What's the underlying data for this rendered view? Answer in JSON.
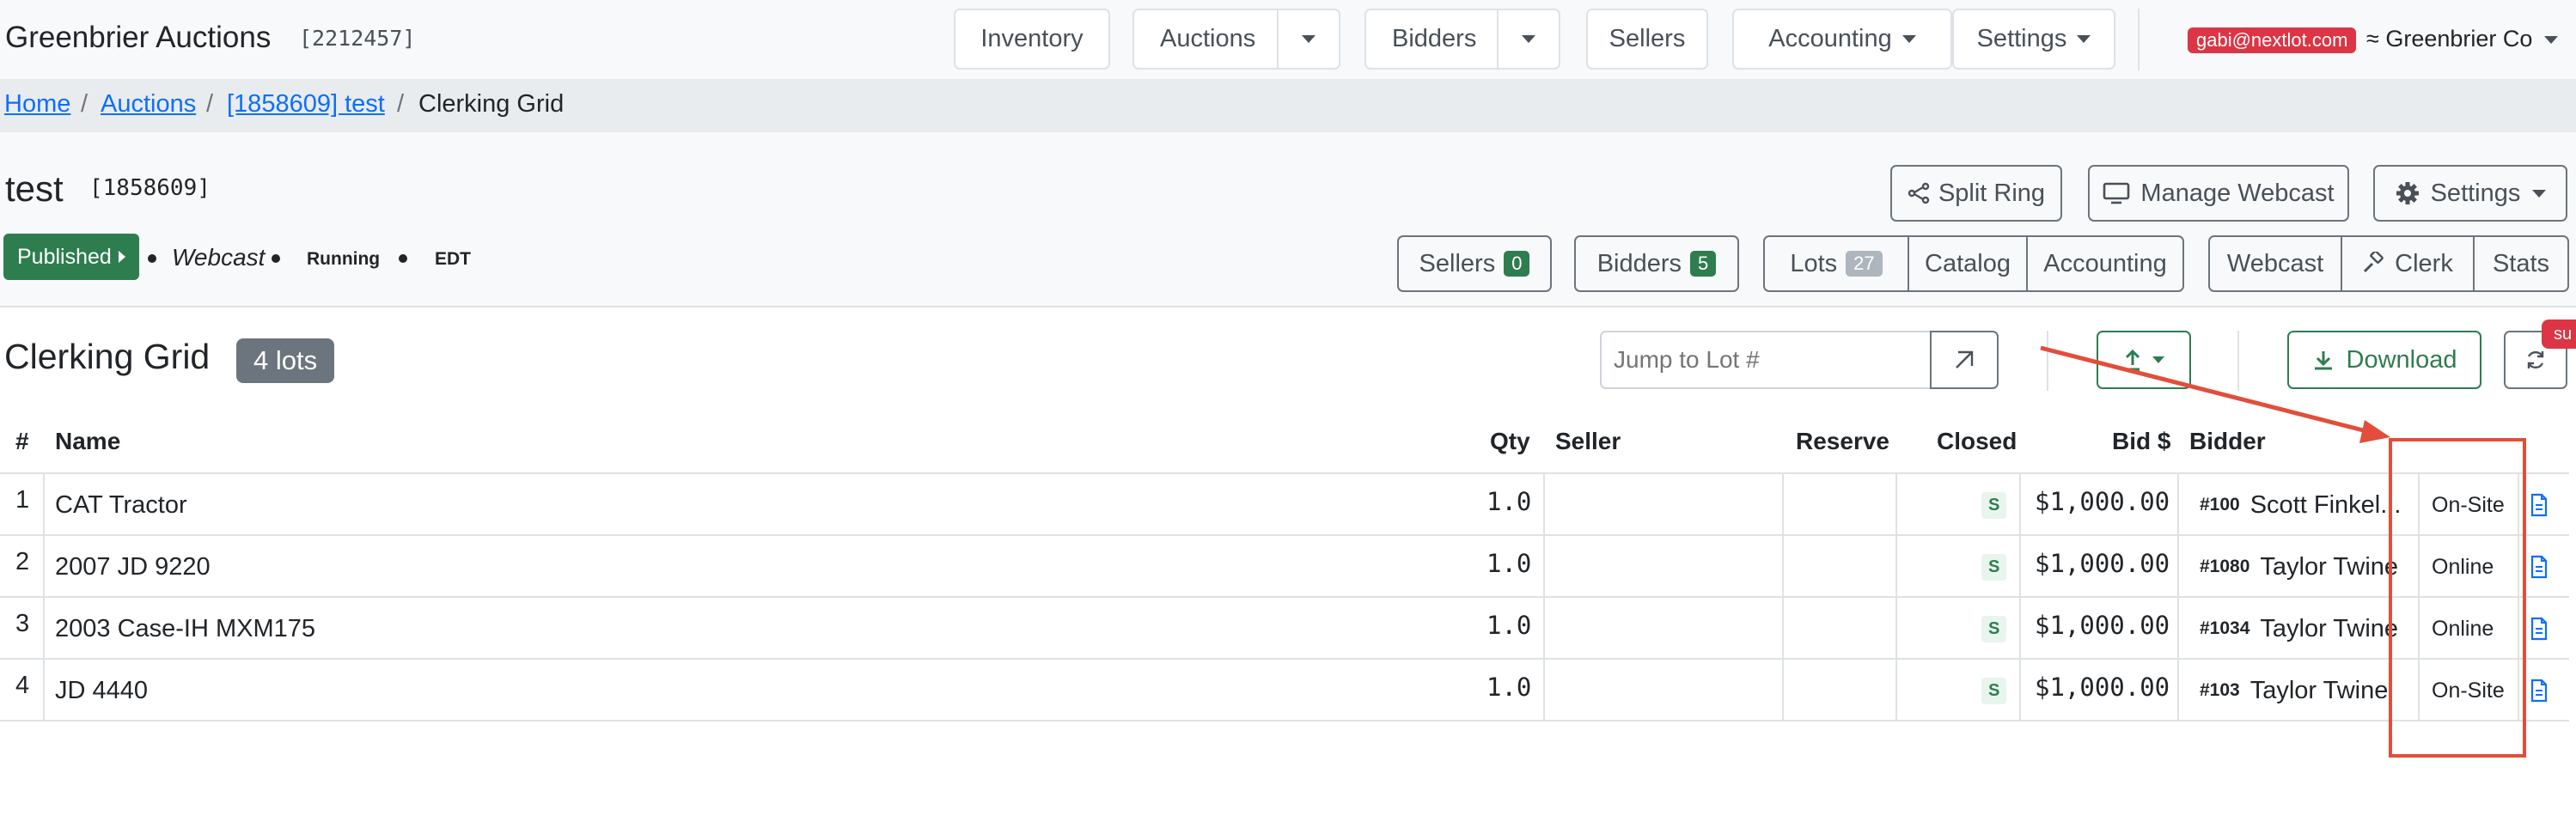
{
  "navbar": {
    "brand": "Greenbrier Auctions",
    "account_id": "[2212457]",
    "inventory": "Inventory",
    "auctions": "Auctions",
    "bidders": "Bidders",
    "sellers": "Sellers",
    "accounting": "Accounting",
    "settings": "Settings",
    "user_email": "gabi@nextlot.com",
    "org": "≈ Greenbrier Co"
  },
  "breadcrumb": {
    "home": "Home",
    "auctions": "Auctions",
    "auction": "[1858609] test",
    "current": "Clerking Grid",
    "sep": "/"
  },
  "auction": {
    "title": "test",
    "id": "[1858609]",
    "status_button": "Published",
    "type": "Webcast",
    "state": "Running",
    "timezone": "EDT",
    "split_ring": "Split Ring",
    "manage_webcast": "Manage Webcast",
    "settings": "Settings",
    "tabs": {
      "sellers": "Sellers",
      "sellers_count": "0",
      "bidders": "Bidders",
      "bidders_count": "5",
      "lots": "Lots",
      "lots_count": "27",
      "catalog": "Catalog",
      "accounting": "Accounting",
      "webcast": "Webcast",
      "clerk": "Clerk",
      "stats": "Stats"
    }
  },
  "grid": {
    "title": "Clerking Grid",
    "lots_badge": "4 lots",
    "jump_placeholder": "Jump to Lot #",
    "download": "Download",
    "corner_badge": "su",
    "columns": {
      "num": "#",
      "name": "Name",
      "qty": "Qty",
      "seller": "Seller",
      "reserve": "Reserve",
      "closed": "Closed",
      "bid": "Bid $",
      "bidder": "Bidder"
    },
    "rows": [
      {
        "num": "1",
        "name": "CAT Tractor",
        "qty": "1.0",
        "closed": "S",
        "bid": "$1,000.00",
        "bidder_num": "#100",
        "bidder_name": "Scott Finkel...",
        "source": "On-Site"
      },
      {
        "num": "2",
        "name": "2007 JD 9220",
        "qty": "1.0",
        "closed": "S",
        "bid": "$1,000.00",
        "bidder_num": "#1080",
        "bidder_name": "Taylor Twine",
        "source": "Online"
      },
      {
        "num": "3",
        "name": "2003 Case-IH MXM175",
        "qty": "1.0",
        "closed": "S",
        "bid": "$1,000.00",
        "bidder_num": "#1034",
        "bidder_name": "Taylor Twine",
        "source": "Online"
      },
      {
        "num": "4",
        "name": "JD 4440",
        "qty": "1.0",
        "closed": "S",
        "bid": "$1,000.00",
        "bidder_num": "#103",
        "bidder_name": "Taylor Twine",
        "source": "On-Site"
      }
    ]
  },
  "colors": {
    "accent_green": "#2e7d4f",
    "danger": "#dc3545",
    "link": "#0d6efd",
    "annotation": "#e24e3a"
  }
}
